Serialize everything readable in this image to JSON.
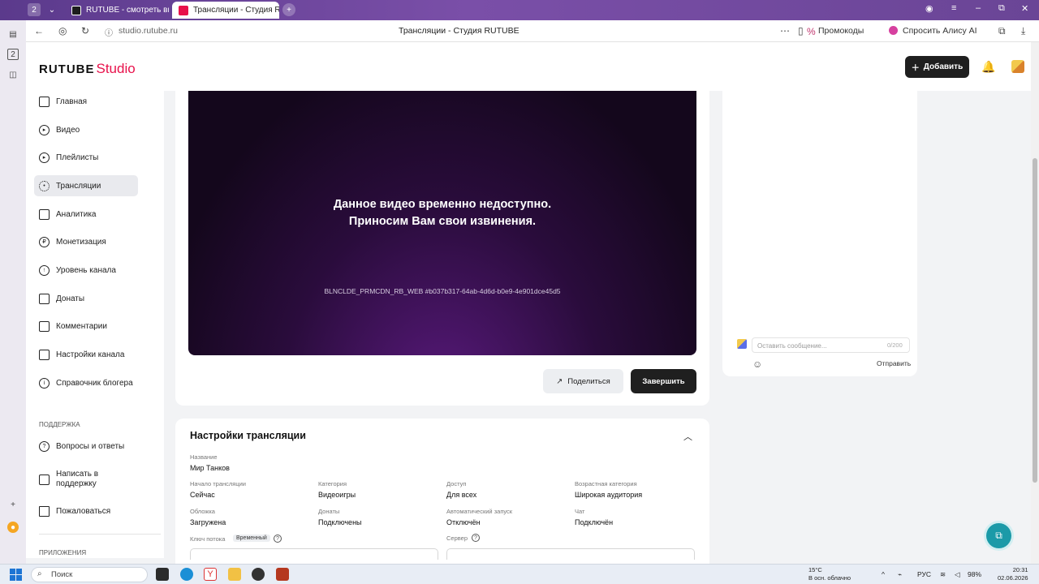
{
  "browser": {
    "tabs": [
      {
        "label": "RUTUBE - смотреть видео"
      },
      {
        "label": "Трансляции - Студия R"
      }
    ],
    "url": "studio.rutube.ru",
    "page_title": "Трансляции - Студия RUTUBE",
    "promo_label": "Промокоды",
    "alice_label": "Спросить Алису AI"
  },
  "header": {
    "logo_main": "RUTUBE",
    "logo_suffix": "Studio",
    "add_label": "Добавить"
  },
  "sidebar": {
    "items": [
      {
        "label": "Главная",
        "icon": "home-icon"
      },
      {
        "label": "Видео",
        "icon": "video-icon"
      },
      {
        "label": "Плейлисты",
        "icon": "playlist-icon"
      },
      {
        "label": "Трансляции",
        "icon": "broadcast-icon",
        "active": true
      },
      {
        "label": "Аналитика",
        "icon": "analytics-icon"
      },
      {
        "label": "Монетизация",
        "icon": "ruble-icon"
      },
      {
        "label": "Уровень канала",
        "icon": "level-icon"
      },
      {
        "label": "Донаты",
        "icon": "donate-icon"
      },
      {
        "label": "Комментарии",
        "icon": "comment-icon"
      },
      {
        "label": "Настройки канала",
        "icon": "settings-icon"
      },
      {
        "label": "Справочник блогера",
        "icon": "info-icon"
      }
    ],
    "support_label": "ПОДДЕРЖКА",
    "support_items": [
      {
        "label": "Вопросы и ответы"
      },
      {
        "label": "Написать в поддержку"
      },
      {
        "label": "Пожаловаться"
      }
    ],
    "apps_label": "ПРИЛОЖЕНИЯ"
  },
  "player": {
    "error_line1": "Данное видео временно недоступно.",
    "error_line2": "Приносим Вам свои извинения.",
    "error_code": "BLNCLDE_PRMCDN_RB_WEB #b037b317-64ab-4d6d-b0e9-4e901dce45d5",
    "share_label": "Поделиться",
    "finish_label": "Завершить"
  },
  "chat": {
    "placeholder": "Оставить сообщение...",
    "counter": "0/200",
    "send_label": "Отправить"
  },
  "settings": {
    "title": "Настройки трансляции",
    "name_label": "Название",
    "name_value": "Мир Танков",
    "fields_row1": [
      {
        "label": "Начало трансляции",
        "value": "Сейчас"
      },
      {
        "label": "Категория",
        "value": "Видеоигры"
      },
      {
        "label": "Доступ",
        "value": "Для всех"
      },
      {
        "label": "Возрастная категория",
        "value": "Широкая аудитория"
      }
    ],
    "fields_row2": [
      {
        "label": "Обложка",
        "value": "Загружена"
      },
      {
        "label": "Донаты",
        "value": "Подключены"
      },
      {
        "label": "Автоматический запуск",
        "value": "Отключён"
      },
      {
        "label": "Чат",
        "value": "Подключён"
      }
    ],
    "key_label": "Ключ потока",
    "key_badge": "Временный",
    "server_label": "Сервер"
  },
  "taskbar": {
    "search_label": "Поиск",
    "weather_temp": "15°C",
    "weather_desc": "В осн. облачно",
    "lang": "РУС",
    "battery": "98%",
    "time": "20:31",
    "date": "02.06.2026"
  }
}
